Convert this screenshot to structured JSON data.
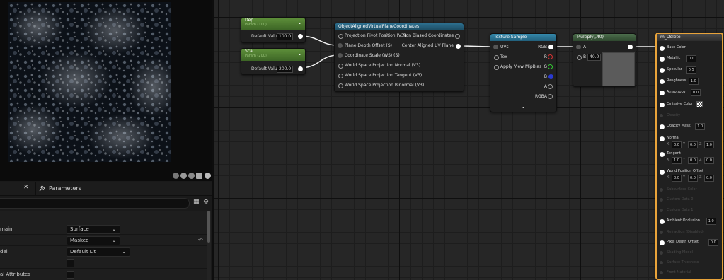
{
  "left_panel": {
    "tab_close": "✕",
    "parameters_tab": "Parameters",
    "details_rows": [
      {
        "label": "main",
        "value": "Surface"
      },
      {
        "label": "",
        "value": "Masked"
      },
      {
        "label": "del",
        "value": "Default Lit"
      },
      {
        "label": "",
        "value": ""
      },
      {
        "label": "al Attributes",
        "value": ""
      }
    ]
  },
  "nodes": {
    "dep": {
      "title": "Dep",
      "sub": "Param (100)",
      "pin": "Default Value",
      "value": "100.0"
    },
    "sca": {
      "title": "Sca",
      "sub": "Param (200)",
      "pin": "Default Value",
      "value": "200.0"
    },
    "oavpc": {
      "title": "ObjectAlignedVirtualPlaneCoordinates",
      "inputs": [
        "Projection Pivot Position (V3)",
        "Plane Depth Offset (S)",
        "Coordinate Scale (WS) (S)",
        "World Space Projection Normal (V3)",
        "World Space Projection Tangent (V3)",
        "World Space Projection Binormal (V3)"
      ],
      "outputs": [
        "Non Biased Coordinates",
        "Center Aligned UV Plane"
      ]
    },
    "texture_sample": {
      "title": "Texture Sample",
      "inputs": [
        "UVs",
        "Tex",
        "Apply View MipBias"
      ],
      "outputs": [
        "RGB",
        "R",
        "G",
        "B",
        "A",
        "RGBA"
      ]
    },
    "multiply": {
      "title": "Multiply(,40)",
      "a": "A",
      "b": "B",
      "b_value": "40.0"
    },
    "material": {
      "title": "m_Delete",
      "pins": [
        {
          "label": "Base Color",
          "active": true
        },
        {
          "label": "Metallic",
          "active": true,
          "value": "0.0"
        },
        {
          "label": "Specular",
          "active": true,
          "value": "0.5"
        },
        {
          "label": "Roughness",
          "active": true,
          "value": "1.0"
        },
        {
          "label": "Anisotropy",
          "active": true,
          "value": "0.0"
        },
        {
          "label": "Emissive Color",
          "active": true
        },
        {
          "label": "Opacity",
          "active": false
        },
        {
          "label": "Opacity Mask",
          "active": true,
          "value": "1.0"
        },
        {
          "label": "Normal",
          "active": true,
          "vec": [
            "0.0",
            "0.0",
            "1.0"
          ]
        },
        {
          "label": "Tangent",
          "active": true,
          "vec": [
            "1.0",
            "0.0",
            "0.0"
          ]
        },
        {
          "label": "World Position Offset",
          "active": true,
          "vec": [
            "0.0",
            "0.0",
            "0.0"
          ]
        },
        {
          "label": "Subsurface Color",
          "active": false
        },
        {
          "label": "Custom Data 0",
          "active": false
        },
        {
          "label": "Custom Data 1",
          "active": false
        },
        {
          "label": "Ambient Occlusion",
          "active": true,
          "value": "1.0"
        },
        {
          "label": "Refraction (Disabled)",
          "active": false
        },
        {
          "label": "Pixel Depth Offset",
          "active": true,
          "value": "0.0"
        },
        {
          "label": "Shading Model",
          "active": false
        },
        {
          "label": "Surface Thickness",
          "active": false
        },
        {
          "label": "Front Material",
          "active": false
        }
      ]
    }
  },
  "colors": {
    "param_header": "#4e7a2f",
    "function_header": "#1f4d66",
    "texture_header": "#2a6d8a",
    "math_header": "#3a5a3a",
    "material_outline": "#e8a33a"
  }
}
